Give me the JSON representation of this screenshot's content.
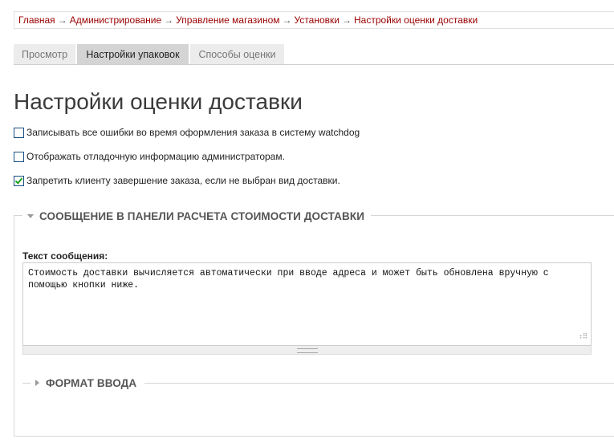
{
  "breadcrumb": {
    "items": [
      "Главная",
      "Администрирование",
      "Управление магазином",
      "Установки",
      "Настройки оценки доставки"
    ],
    "separator": "→"
  },
  "tabs": [
    {
      "label": "Просмотр",
      "active": false
    },
    {
      "label": "Настройки упаковок",
      "active": true
    },
    {
      "label": "Способы оценки",
      "active": false
    }
  ],
  "page": {
    "title": "Настройки оценки доставки"
  },
  "options": [
    {
      "label": "Записывать все ошибки во время оформления заказа в систему watchdog",
      "checked": false
    },
    {
      "label": "Отображать отладочную информацию администраторам.",
      "checked": false
    },
    {
      "label": "Запретить клиенту завершение заказа, если не выбран вид доставки.",
      "checked": true
    }
  ],
  "fieldset": {
    "legend": "СООБЩЕНИЕ В ПАНЕЛИ РАСЧЕТА СТОИМОСТИ ДОСТАВКИ",
    "message_label": "Текст сообщения:",
    "message_value": "Стоимость доставки вычисляется автоматически при вводе адреса и может быть обновлена вручную с помощью кнопки ниже.",
    "format_legend": "ФОРМАТ ВВОДА"
  },
  "colors": {
    "link": "#9a0000",
    "check": "#21a121",
    "tab_active": "#d4d4d4",
    "tab_inactive": "#ececec"
  },
  "icons": {
    "expanded": "triangle-down-icon",
    "collapsed": "triangle-right-icon"
  }
}
